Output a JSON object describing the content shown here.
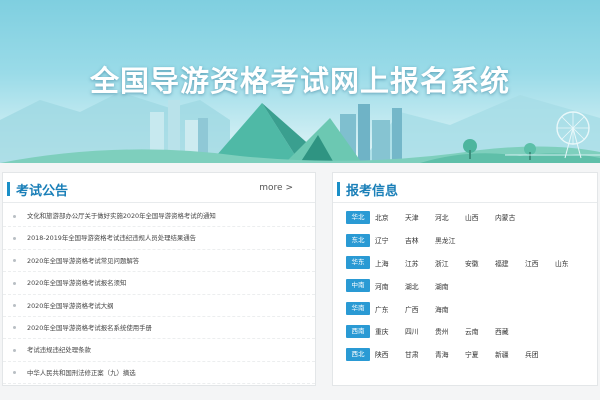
{
  "banner": {
    "title": "全国导游资格考试网上报名系统"
  },
  "notices": {
    "title": "考试公告",
    "more_label": "more >",
    "items": [
      "文化和旅游部办公厅关于做好实施2020年全国导游资格考试的通知",
      "2018-2019年全国导游资格考试违纪违规人员处理结果通告",
      "2020年全国导游资格考试常见问题解答",
      "2020年全国导游资格考试报名须知",
      "2020年全国导游资格考试大纲",
      "2020年全国导游资格考试报名系统使用手册",
      "考试违规违纪处理条款",
      "中华人民共和国刑法修正案（九）摘选"
    ]
  },
  "registration": {
    "title": "报考信息",
    "regions": [
      {
        "name": "华北",
        "provinces": [
          "北京",
          "天津",
          "河北",
          "山西",
          "内蒙古"
        ]
      },
      {
        "name": "东北",
        "provinces": [
          "辽宁",
          "吉林",
          "黑龙江"
        ]
      },
      {
        "name": "华东",
        "provinces": [
          "上海",
          "江苏",
          "浙江",
          "安徽",
          "福建",
          "江西",
          "山东"
        ]
      },
      {
        "name": "中南",
        "provinces": [
          "河南",
          "湖北",
          "湖南"
        ]
      },
      {
        "name": "华南",
        "provinces": [
          "广东",
          "广西",
          "海南"
        ]
      },
      {
        "name": "西南",
        "provinces": [
          "重庆",
          "四川",
          "贵州",
          "云南",
          "西藏"
        ]
      },
      {
        "name": "西北",
        "provinces": [
          "陕西",
          "甘肃",
          "青海",
          "宁夏",
          "新疆",
          "兵团"
        ]
      }
    ]
  },
  "colors": {
    "accent": "#1a8fc7",
    "badge": "#2a9ad4",
    "banner_sky": "#7fcfe0"
  }
}
